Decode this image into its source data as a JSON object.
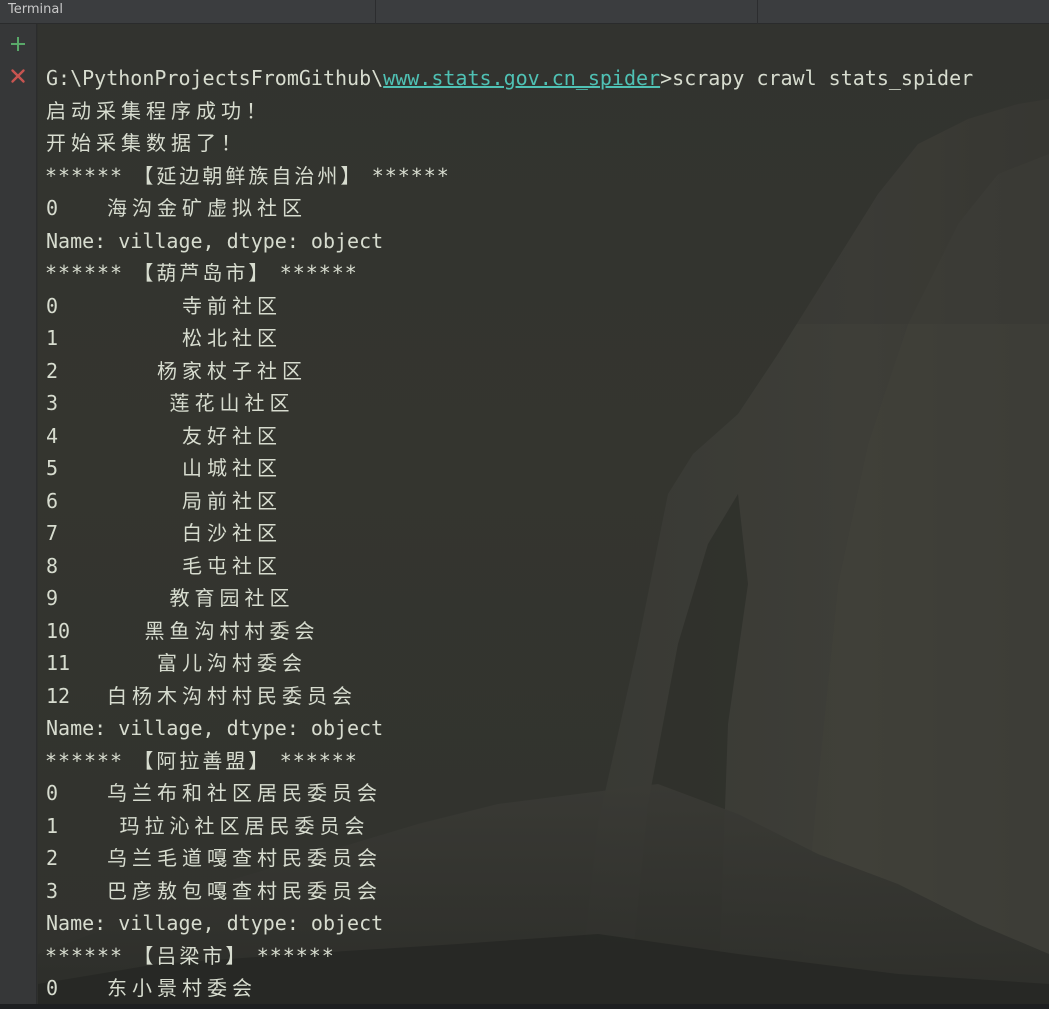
{
  "window": {
    "tab_title": "Terminal"
  },
  "toolbar": {
    "new_session": "+",
    "close_session": "×"
  },
  "command": {
    "path_prefix": "G:\\PythonProjectsFromGithub\\",
    "path_link": "www.stats.gov.cn_spider",
    "command_text": ">scrapy crawl stats_spider"
  },
  "status": [
    "启动采集程序成功！",
    "开始采集数据了！"
  ],
  "groups": [
    {
      "header": "****** 【延边朝鲜族自治州】 ******",
      "rows": [
        {
          "index": "0",
          "value": "海沟金矿虚拟社区"
        }
      ],
      "footer": "Name: village, dtype: object"
    },
    {
      "header": "****** 【葫芦岛市】 ******",
      "rows": [
        {
          "index": "0",
          "value": "寺前社区"
        },
        {
          "index": "1",
          "value": "松北社区"
        },
        {
          "index": "2",
          "value": "杨家杖子社区"
        },
        {
          "index": "3",
          "value": "莲花山社区"
        },
        {
          "index": "4",
          "value": "友好社区"
        },
        {
          "index": "5",
          "value": "山城社区"
        },
        {
          "index": "6",
          "value": "局前社区"
        },
        {
          "index": "7",
          "value": "白沙社区"
        },
        {
          "index": "8",
          "value": "毛屯社区"
        },
        {
          "index": "9",
          "value": "教育园社区"
        },
        {
          "index": "10",
          "value": "黑鱼沟村村委会"
        },
        {
          "index": "11",
          "value": "富儿沟村委会"
        },
        {
          "index": "12",
          "value": "白杨木沟村村民委员会"
        }
      ],
      "footer": "Name: village, dtype: object"
    },
    {
      "header": "****** 【阿拉善盟】 ******",
      "rows": [
        {
          "index": "0",
          "value": "乌兰布和社区居民委员会"
        },
        {
          "index": "1",
          "value": "玛拉沁社区居民委员会"
        },
        {
          "index": "2",
          "value": "乌兰毛道嘎查村民委员会"
        },
        {
          "index": "3",
          "value": "巴彦敖包嘎查村民委员会"
        }
      ],
      "footer": "Name: village, dtype: object"
    },
    {
      "header": "****** 【吕梁市】 ******",
      "rows": [
        {
          "index": "0",
          "value": "东小景村委会"
        }
      ]
    }
  ],
  "colors": {
    "text": "#d7dccf",
    "link": "#4fc1b4",
    "add_icon": "#59a869",
    "close_icon": "#c75450",
    "background": "#32332f"
  }
}
